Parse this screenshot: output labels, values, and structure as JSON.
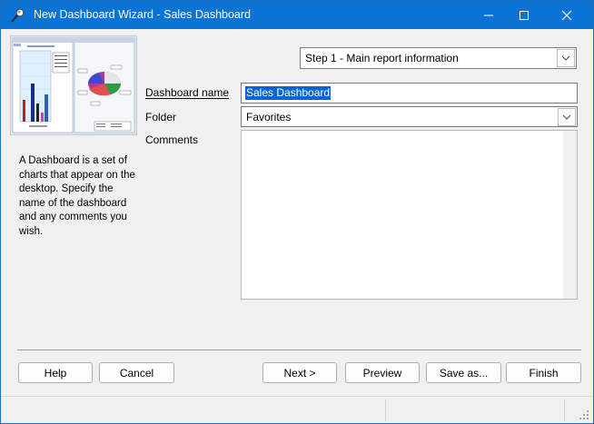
{
  "window": {
    "title": "New Dashboard Wizard - Sales Dashboard",
    "title_icon": "pushpin-icon",
    "controls": [
      "minimize-icon",
      "maximize-icon",
      "close-icon"
    ]
  },
  "description": "A Dashboard is a set of charts that appear on the desktop. Specify the name of the dashboard and any comments you wish.",
  "step_select": {
    "value": "Step 1 - Main report information"
  },
  "form": {
    "name_label": "Dashboard name",
    "name_value": "Sales Dashboard",
    "folder_label": "Folder",
    "folder_value": "Favorites",
    "comments_label": "Comments",
    "comments_value": ""
  },
  "buttons": {
    "help": "Help",
    "cancel": "Cancel",
    "next": "Next >",
    "preview": "Preview",
    "save_as": "Save as...",
    "finish": "Finish"
  },
  "colors": {
    "titlebar": "#0b73d4",
    "selection": "#0a64d2",
    "dialog_bg": "#f0f0f0"
  }
}
